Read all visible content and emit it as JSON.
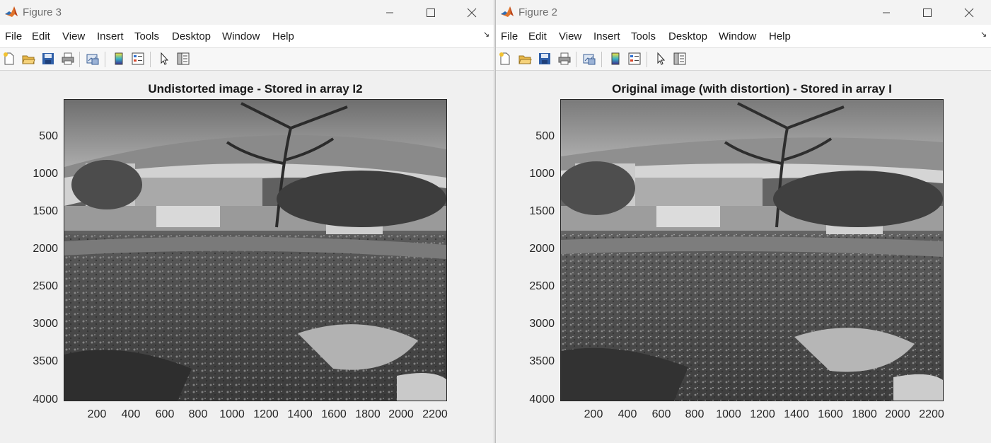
{
  "windows": [
    {
      "id": "left",
      "title": "Figure 3",
      "menus": [
        "File",
        "Edit",
        "View",
        "Insert",
        "Tools",
        "Desktop",
        "Window",
        "Help"
      ],
      "plot_title": "Undistorted image - Stored in array I2",
      "image_description_icon": "grayscale-pond-photo"
    },
    {
      "id": "right",
      "title": "Figure 2",
      "menus": [
        "File",
        "Edit",
        "View",
        "Insert",
        "Tools",
        "Desktop",
        "Window",
        "Help"
      ],
      "plot_title": "Original image (with distortion) - Stored in array I",
      "image_description_icon": "grayscale-pond-photo"
    }
  ],
  "axes": {
    "y_ticks": [
      "500",
      "1000",
      "1500",
      "2000",
      "2500",
      "3000",
      "3500",
      "4000"
    ],
    "x_ticks": [
      "200",
      "400",
      "600",
      "800",
      "1000",
      "1200",
      "1400",
      "1600",
      "1800",
      "2000",
      "2200"
    ]
  },
  "toolbar_icons": [
    "new-figure-icon",
    "open-file-icon",
    "save-icon",
    "print-icon",
    "link-plot-icon",
    "insert-colorbar-icon",
    "insert-legend-icon",
    "edit-plot-arrow-icon",
    "property-inspector-icon"
  ],
  "window_controls": [
    "minimize-icon",
    "maximize-icon",
    "close-icon"
  ],
  "colors": {
    "menubar_bg": "#ffffff",
    "figure_bg": "#f0f0f0",
    "axes_border": "#262626"
  }
}
